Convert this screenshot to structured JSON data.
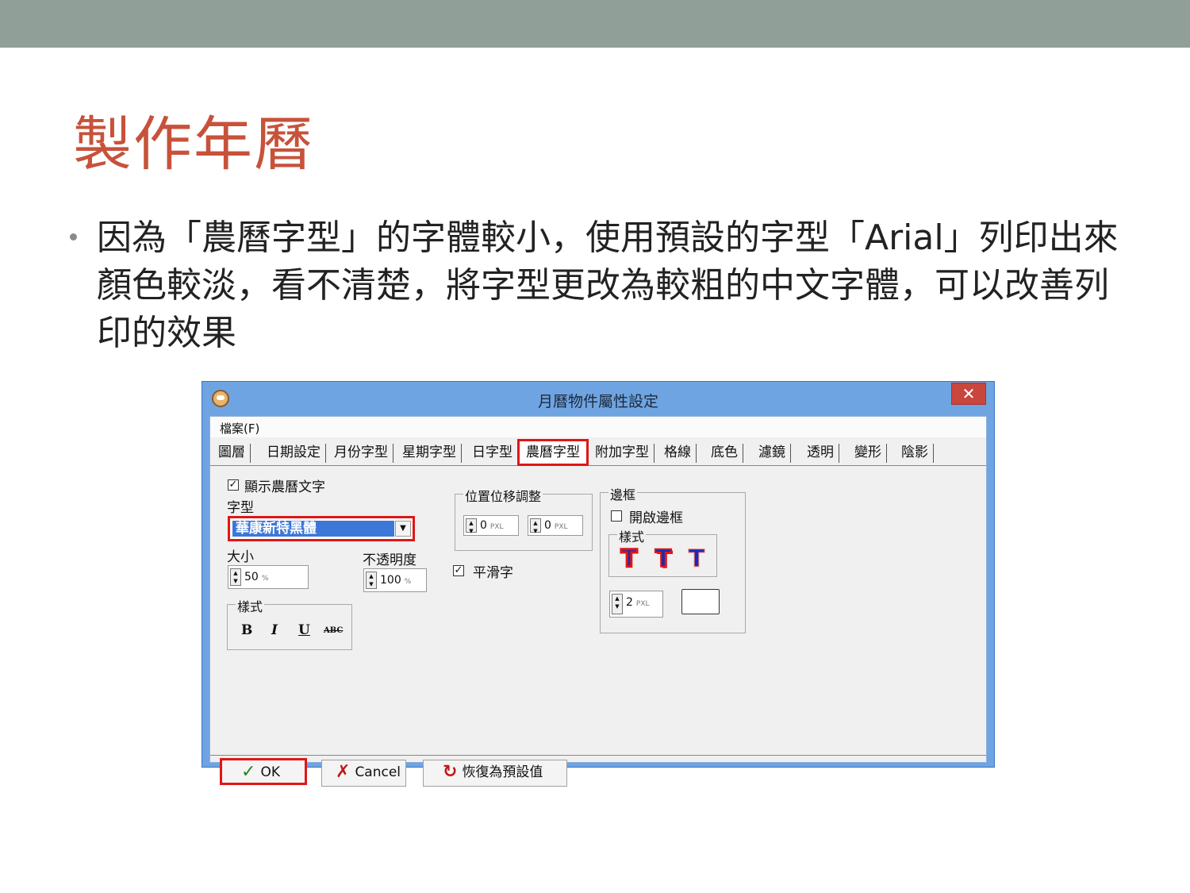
{
  "slide": {
    "title": "製作年曆",
    "bullet": "因為「農曆字型」的字體較小，使用預設的字型「Arial」列印出來顏色較淡，看不清楚，將字型更改為較粗的中文字體，可以改善列印的效果"
  },
  "dialog": {
    "title": "月曆物件屬性設定",
    "close_label": "✕",
    "menu_file": "檔案(F)",
    "tabs": [
      "圖層",
      "日期設定",
      "月份字型",
      "星期字型",
      "日字型",
      "農曆字型",
      "附加字型",
      "格線",
      "底色",
      "濾鏡",
      "透明",
      "變形",
      "陰影"
    ],
    "active_tab": "農曆字型",
    "show_lunar_label": "顯示農曆文字",
    "show_lunar_checked": "✓",
    "font_label": "字型",
    "font_value": "華康新特黑體",
    "size_label": "大小",
    "size_value": "50",
    "size_unit": "%",
    "opacity_label": "不透明度",
    "opacity_value": "100",
    "opacity_unit": "%",
    "style_group_label": "樣式",
    "style_buttons": [
      "B",
      "I",
      "U",
      "ABC"
    ],
    "offset_group_label": "位置位移調整",
    "offset_x_value": "0",
    "offset_y_value": "0",
    "offset_unit": "PXL",
    "smooth_label": "平滑字",
    "smooth_checked": "✓",
    "border_group_label": "邊框",
    "border_enable_label": "開啟邊框",
    "border_style_label": "樣式",
    "border_styles": [
      "T",
      "T",
      "T"
    ],
    "border_width_value": "2",
    "border_width_unit": "PXL",
    "btn_ok": "OK",
    "btn_cancel": "Cancel",
    "btn_reset": "恢復為預設值",
    "colors": {
      "title_bar": "#6fa4e2",
      "highlight": "#e01616",
      "ok_icon": "#1e8a1e",
      "cancel_icon": "#c01818"
    }
  }
}
